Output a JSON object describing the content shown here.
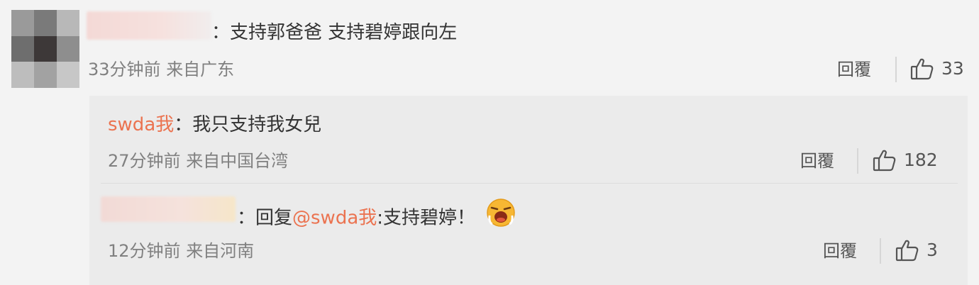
{
  "comments": [
    {
      "text": "：支持郭爸爸 支持碧婷跟向左",
      "time": "33分钟前",
      "location": "来自广东",
      "reply_label": "回覆",
      "likes": "33"
    }
  ],
  "replies": [
    {
      "user": "swda我",
      "text": "：我只支持我女兒",
      "time": "27分钟前",
      "location": "来自中国台湾",
      "reply_label": "回覆",
      "likes": "182"
    },
    {
      "prefix": "：回复",
      "mention": "@swda我",
      "text": ":支持碧婷！",
      "emoji": "crying-face-emoji",
      "time": "12分钟前",
      "location": "来自河南",
      "reply_label": "回覆",
      "likes": "3"
    }
  ],
  "colors": {
    "username": "#eb7350",
    "meta": "#808080",
    "subbox_bg": "#ebebeb",
    "page_bg": "#f3f3f3"
  }
}
